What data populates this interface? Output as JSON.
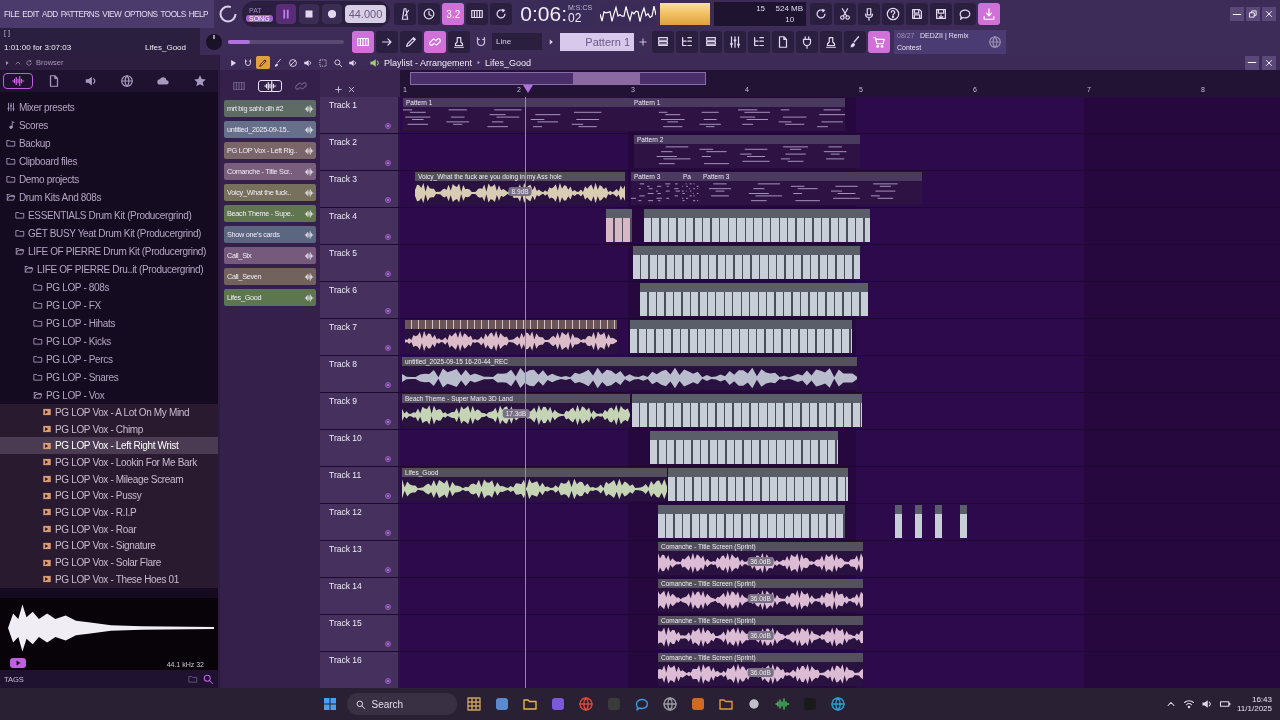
{
  "menu": [
    "FILE",
    "EDIT",
    "ADD",
    "PATTERNS",
    "VIEW",
    "OPTIONS",
    "TOOLS",
    "HELP"
  ],
  "mode": [
    {
      "label": "PAT",
      "selected": false
    },
    {
      "label": "SONG",
      "selected": true
    }
  ],
  "transport": {
    "playing": true,
    "tempo": "44.000"
  },
  "tools_a": [
    {
      "kind": "metronome",
      "on": false
    },
    {
      "kind": "clock",
      "on": false
    },
    {
      "kind": "count",
      "label": "3.2",
      "on": true
    },
    {
      "kind": "piano",
      "on": false
    },
    {
      "kind": "refresh",
      "on": false
    }
  ],
  "time": {
    "main": "0:06:",
    "fraction": "02",
    "unit": "M:S:CS"
  },
  "cpu": {
    "cpu": "15",
    "memory": "524 MB",
    "polyphony": "10"
  },
  "tools_b": [
    {
      "kind": "refresh",
      "on": false
    },
    {
      "kind": "scissors",
      "on": false
    },
    {
      "kind": "mic",
      "on": false
    },
    {
      "kind": "help",
      "on": false
    },
    {
      "kind": "save",
      "on": false
    },
    {
      "kind": "export",
      "on": false
    },
    {
      "kind": "chat",
      "on": false
    },
    {
      "kind": "download",
      "on": true
    }
  ],
  "hint": {
    "marker": "[ ]",
    "text": "1:01:00 for 3:07:03",
    "name": "Lifes_Good"
  },
  "master": {
    "level": 0.19
  },
  "tools_c": [
    {
      "kind": "piano",
      "on": true
    },
    {
      "kind": "arrow",
      "on": false
    },
    {
      "kind": "pencil",
      "on": false
    },
    {
      "kind": "link",
      "on": true
    },
    {
      "kind": "stamp",
      "on": false
    }
  ],
  "snap": "Line",
  "pattern": "Pattern 1",
  "tools_d": [
    {
      "kind": "list",
      "on": false
    },
    {
      "kind": "tree",
      "on": false
    },
    {
      "kind": "list",
      "on": false
    },
    {
      "kind": "mixer",
      "on": false
    },
    {
      "kind": "tree",
      "on": false
    },
    {
      "kind": "doc",
      "on": false
    },
    {
      "kind": "plug",
      "on": false
    },
    {
      "kind": "stamp",
      "on": false
    },
    {
      "kind": "brush",
      "on": false
    },
    {
      "kind": "cart",
      "on": true
    }
  ],
  "news": {
    "date": "08/27",
    "title": "DEDZII | Remix",
    "subtitle": "Contest"
  },
  "browser": {
    "title": "Browser",
    "tabs": [
      {
        "kind": "wave",
        "selected": true
      },
      {
        "kind": "doc",
        "selected": false
      },
      {
        "kind": "speaker",
        "selected": false
      },
      {
        "kind": "globe",
        "selected": false
      },
      {
        "kind": "cloud",
        "selected": false
      },
      {
        "kind": "star",
        "selected": false
      }
    ],
    "tree": [
      {
        "kind": "mixer",
        "label": "Mixer presets",
        "selected": false
      },
      {
        "kind": "note",
        "label": "Scores",
        "selected": false
      },
      {
        "kind": "folder",
        "label": "Backup",
        "selected": false,
        "expanded": false
      },
      {
        "kind": "folder",
        "label": "Clipboard files",
        "selected": false,
        "expanded": false
      },
      {
        "kind": "folder",
        "label": "Demo projects",
        "selected": false,
        "expanded": false
      },
      {
        "kind": "folder",
        "label": "Drum Kits And 808s",
        "selected": false,
        "expanded": true,
        "children": [
          {
            "kind": "folder",
            "label": "ESSENTIALS Drum Kit (Producergrind)",
            "selected": false,
            "expanded": false
          },
          {
            "kind": "folder",
            "label": "GËT BUSY Yeat Drum Kit (Producergrind)",
            "selected": false,
            "expanded": false
          },
          {
            "kind": "folder",
            "label": "LIFE OF PIERRE Drum Kit (Producergrind)",
            "selected": false,
            "expanded": true,
            "children": [
              {
                "kind": "folder",
                "label": "LIFE OF PIERRE Dru..it (Producergrind)",
                "selected": false,
                "expanded": true,
                "children": [
                  {
                    "kind": "folder",
                    "label": "PG LOP - 808s",
                    "selected": false,
                    "expanded": false
                  },
                  {
                    "kind": "folder",
                    "label": "PG LOP - FX",
                    "selected": false,
                    "expanded": false
                  },
                  {
                    "kind": "folder",
                    "label": "PG LOP - Hihats",
                    "selected": false,
                    "expanded": false
                  },
                  {
                    "kind": "folder",
                    "label": "PG LOP - Kicks",
                    "selected": false,
                    "expanded": false
                  },
                  {
                    "kind": "folder",
                    "label": "PG LOP - Percs",
                    "selected": false,
                    "expanded": false
                  },
                  {
                    "kind": "folder",
                    "label": "PG LOP - Snares",
                    "selected": false,
                    "expanded": false
                  },
                  {
                    "kind": "folder",
                    "label": "PG LOP - Vox",
                    "selected": false,
                    "expanded": true,
                    "children": [
                      {
                        "kind": "file",
                        "label": "PG LOP Vox - A Lot On My Mind",
                        "selected": false
                      },
                      {
                        "kind": "file",
                        "label": "PG LOP Vox - Chimp",
                        "selected": false
                      },
                      {
                        "kind": "file",
                        "label": "PG LOP Vox - Left Right Wrist",
                        "selected": true
                      },
                      {
                        "kind": "file",
                        "label": "PG LOP Vox - Lookin For Me Bark",
                        "selected": false
                      },
                      {
                        "kind": "file",
                        "label": "PG LOP Vox - Mileage Scream",
                        "selected": false
                      },
                      {
                        "kind": "file",
                        "label": "PG LOP Vox - Pussy",
                        "selected": false
                      },
                      {
                        "kind": "file",
                        "label": "PG LOP Vox - R.I.P",
                        "selected": false
                      },
                      {
                        "kind": "file",
                        "label": "PG LOP Vox - Roar",
                        "selected": false
                      },
                      {
                        "kind": "file",
                        "label": "PG LOP Vox - Signature",
                        "selected": false
                      },
                      {
                        "kind": "file",
                        "label": "PG LOP Vox - Solar Flare",
                        "selected": false
                      },
                      {
                        "kind": "file",
                        "label": "PG LOP Vox - These Hoes 01",
                        "selected": false
                      }
                    ]
                  }
                ]
              }
            ]
          }
        ]
      }
    ],
    "sample_info": "44.1 kHz 32",
    "tags": "TAGS"
  },
  "playlist": {
    "title": "Playlist - Arrangement",
    "song": "Lifes_Good",
    "tools": [
      {
        "kind": "play",
        "selected": false
      },
      {
        "kind": "magnet",
        "selected": false
      },
      {
        "kind": "pencil",
        "selected": true
      },
      {
        "kind": "brush",
        "selected": false
      },
      {
        "kind": "noentry",
        "selected": false
      },
      {
        "kind": "speaker",
        "selected": false
      },
      {
        "kind": "select",
        "selected": false
      },
      {
        "kind": "search",
        "selected": false
      },
      {
        "kind": "speaker",
        "selected": false
      }
    ],
    "rack_tabs": [
      {
        "kind": "piano",
        "selected": false
      },
      {
        "kind": "wave",
        "selected": true
      },
      {
        "kind": "link",
        "selected": false
      }
    ],
    "channels": [
      {
        "name": "mrt big sahh dih #2",
        "color": "#5d6b64"
      },
      {
        "name": "untitled_2025-09-15..",
        "color": "#66708a"
      },
      {
        "name": "PG LOP Vox - Left Rig..",
        "color": "#7a6668"
      },
      {
        "name": "Comanche - Title Scr..",
        "color": "#7a5f7c"
      },
      {
        "name": "Voicy_What the fuck..",
        "color": "#76705c"
      },
      {
        "name": "Beach Theme - Supe..",
        "color": "#61764f"
      },
      {
        "name": "Show one's cards",
        "color": "#5b6680"
      },
      {
        "name": "Call_Six",
        "color": "#765a7c"
      },
      {
        "name": "Call_Seven",
        "color": "#72625e"
      },
      {
        "name": "Lifes_Good",
        "color": "#5d7650"
      }
    ],
    "ruler": [
      "1",
      "2",
      "3",
      "4",
      "5",
      "6",
      "7",
      "8"
    ],
    "tracks": [
      {
        "name": "Track 1",
        "clips": [
          {
            "kind": "pattern",
            "label": "Pattern 1"
          },
          {
            "kind": "pattern",
            "label": "Pattern 1"
          }
        ]
      },
      {
        "name": "Track 2",
        "clips": [
          {
            "kind": "pattern",
            "label": "Pattern 2"
          }
        ]
      },
      {
        "name": "Track 3",
        "clips": [
          {
            "kind": "audio",
            "label": "Voicy_What the fuck are you doing in my Ass hole",
            "gain": "8.9dB",
            "color": "#d8ccb4"
          },
          {
            "kind": "pattern",
            "label": "Pattern 3"
          },
          {
            "kind": "pattern",
            "label": "Pa"
          },
          {
            "kind": "pattern",
            "label": "Pattern 3"
          }
        ]
      },
      {
        "name": "Track 4",
        "clips": [
          {
            "kind": "slices",
            "color": "#d8b8c4"
          },
          {
            "kind": "slices",
            "color": "#c8ced8"
          }
        ]
      },
      {
        "name": "Track 5",
        "clips": [
          {
            "kind": "slices",
            "color": "#c8ced8"
          }
        ]
      },
      {
        "name": "Track 6",
        "clips": [
          {
            "kind": "slices",
            "color": "#c8ced8"
          }
        ]
      },
      {
        "name": "Track 7",
        "clips": [
          {
            "kind": "audio",
            "color": "#dcbcc8"
          },
          {
            "kind": "slices",
            "color": "#c8ced8"
          }
        ]
      },
      {
        "name": "Track 8",
        "clips": [
          {
            "kind": "audio",
            "label": "untitled_2025-09-15 16-20-44_REC",
            "color": "#b8bccc"
          }
        ]
      },
      {
        "name": "Track 9",
        "clips": [
          {
            "kind": "audio",
            "label": "Beach Theme - Super Mario 3D Land",
            "gain": "17.3dB",
            "color": "#c4d4b4"
          },
          {
            "kind": "slices",
            "color": "#c8ced8"
          }
        ]
      },
      {
        "name": "Track 10",
        "clips": [
          {
            "kind": "slices",
            "color": "#c8ced8"
          }
        ]
      },
      {
        "name": "Track 11",
        "clips": [
          {
            "kind": "audio",
            "label": "Lifes_Good",
            "color": "#c4d4b4"
          },
          {
            "kind": "slices",
            "color": "#c8ced8"
          }
        ]
      },
      {
        "name": "Track 12",
        "clips": [
          {
            "kind": "slices",
            "color": "#c8ced8"
          },
          {
            "kind": "slices",
            "color": "#c8ced8"
          },
          {
            "kind": "slices",
            "color": "#c8ced8"
          },
          {
            "kind": "slices",
            "color": "#c8ced8"
          },
          {
            "kind": "slices",
            "color": "#c8ced8"
          }
        ]
      },
      {
        "name": "Track 13",
        "clips": [
          {
            "kind": "audio",
            "label": "Comanche - Title Screen (Sprint)",
            "gain": "36.0dB",
            "color": "#dcbcd4"
          }
        ]
      },
      {
        "name": "Track 14",
        "clips": [
          {
            "kind": "audio",
            "label": "Comanche - Title Screen (Sprint)",
            "gain": "36.0dB",
            "color": "#dcbcd4"
          }
        ]
      },
      {
        "name": "Track 15",
        "clips": [
          {
            "kind": "audio",
            "label": "Comanche - Title Screen (Sprint)",
            "gain": "36.0dB",
            "color": "#dcbcd4"
          }
        ]
      },
      {
        "name": "Track 16",
        "clips": [
          {
            "kind": "audio",
            "label": "Comanche - Title Screen (Sprint)",
            "gain": "36.0dB",
            "color": "#dcbcd4"
          }
        ]
      }
    ]
  },
  "taskbar": {
    "search": "Search",
    "time": "16:43",
    "date": "11/1/2025"
  }
}
